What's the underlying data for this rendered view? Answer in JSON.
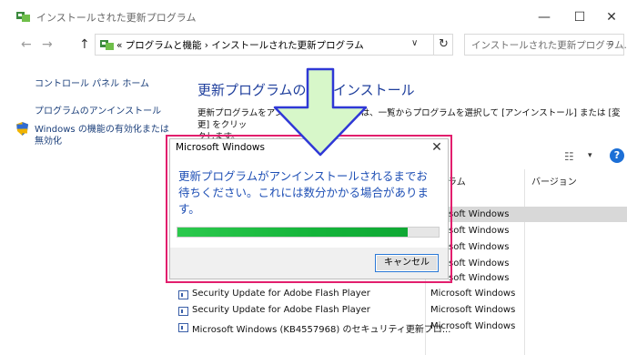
{
  "window": {
    "title": "インストールされた更新プログラム",
    "minimize_glyph": "—",
    "maximize_glyph": "☐",
    "close_glyph": "✕"
  },
  "addressbar": {
    "back_glyph": "←",
    "forward_glyph": "→",
    "up_glyph": "↑",
    "breadcrumb": "« プログラムと機能 › インストールされた更新プログラム",
    "dropdown_glyph": "∨",
    "refresh_glyph": "↻",
    "search_placeholder": "インストールされた更新プログラム...",
    "search_glyph": "⌕"
  },
  "sidebar": {
    "items": [
      {
        "label": "コントロール パネル ホーム"
      },
      {
        "label": "プログラムのアンインストール"
      },
      {
        "label": "Windows の機能の有効化または"
      },
      {
        "label": "無効化"
      }
    ]
  },
  "main": {
    "heading": "更新プログラムのアンインストール",
    "description_line1": "更新プログラムをアンインストールするには、一覧からプログラムを選択して [アンインストール] または [変更] をクリッ",
    "description_line2": "クします。",
    "toolbar": {
      "view_glyph": "☷",
      "dropdown_glyph": "▾",
      "help_label": "?"
    },
    "columns": [
      "ラム",
      "バージョン"
    ],
    "rows": [
      {
        "name": "",
        "publisher": "soft Windows"
      },
      {
        "name": "",
        "publisher": "soft Windows"
      },
      {
        "name": "",
        "publisher": "soft Windows"
      },
      {
        "name": "",
        "publisher": "soft Windows"
      },
      {
        "name": "",
        "publisher": "soft Windows"
      },
      {
        "name": "Security Update for Adobe Flash Player",
        "publisher": "Microsoft Windows"
      },
      {
        "name": "Security Update for Adobe Flash Player",
        "publisher": "Microsoft Windows"
      },
      {
        "name": "Microsoft Windows (KB4557968) のセキュリティ更新プロ...",
        "publisher": "Microsoft Windows"
      }
    ]
  },
  "dialog": {
    "title": "Microsoft Windows",
    "close_glyph": "✕",
    "message": "更新プログラムがアンインストールされるまでお待ちください。これには数分かかる場合があります。",
    "progress": 0.88,
    "cancel_label": "キャンセル"
  },
  "colors": {
    "accent_blue": "#1e4fb5",
    "heading_blue": "#1e3e9c",
    "highlight_pink": "#e21e6d",
    "progress_green": "#14b43a",
    "arrow_fill": "#d7f7c9",
    "arrow_stroke": "#2f38d6"
  }
}
